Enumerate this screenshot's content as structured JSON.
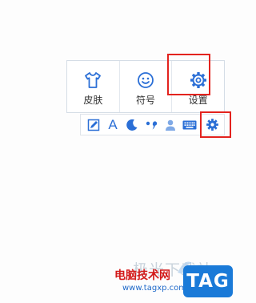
{
  "menu_panel": {
    "items": [
      {
        "label": "皮肤",
        "icon": "shirt-icon"
      },
      {
        "label": "符号",
        "icon": "smiley-icon"
      },
      {
        "label": "设置",
        "icon": "gear-icon"
      }
    ]
  },
  "toolbar": {
    "items": [
      {
        "icon": "edit-square-icon"
      },
      {
        "icon": "font-a-icon",
        "glyph": "A"
      },
      {
        "icon": "moon-icon"
      },
      {
        "icon": "punctuation-icon"
      },
      {
        "icon": "user-icon"
      },
      {
        "icon": "keyboard-icon"
      },
      {
        "icon": "gear-icon"
      }
    ]
  },
  "colors": {
    "icon_blue": "#2b6fd6",
    "highlight_red": "#e3231e",
    "panel_border": "#d5dde6"
  },
  "watermark": {
    "faded_text": "极光下载站",
    "site_name": "电脑技术网",
    "url": "www.tagxp.com",
    "badge": "TAG"
  }
}
